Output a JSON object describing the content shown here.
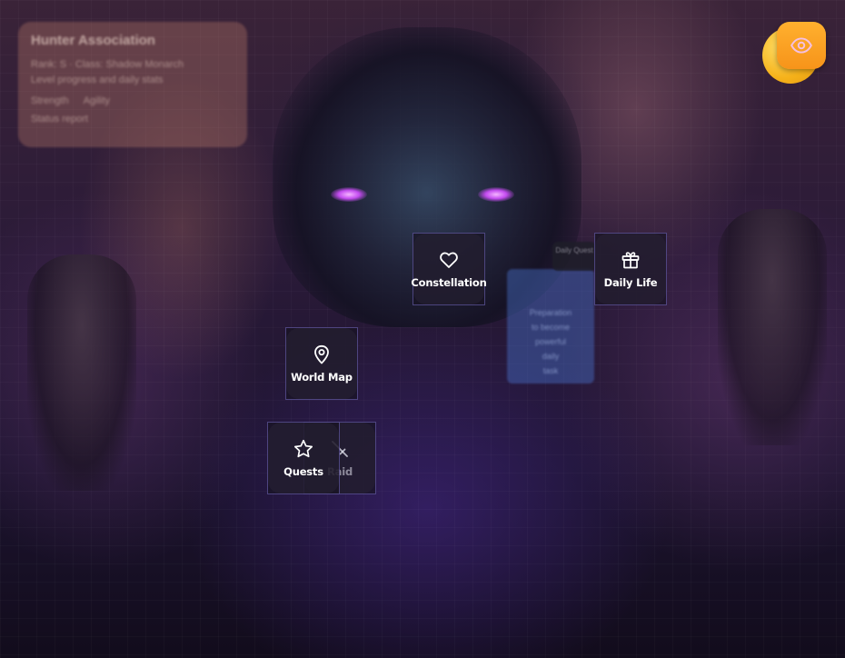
{
  "background_panel": {
    "title": "Hunter Association",
    "lines": [
      "Rank: S · Class: Shadow Monarch",
      "Level progress and daily stats"
    ],
    "stats": [
      "Strength",
      "Agility"
    ],
    "footer": "Status report"
  },
  "note_card": {
    "tab": "Daily Quest",
    "lines": [
      "Preparation",
      "to become",
      "powerful",
      "daily",
      "task"
    ]
  },
  "visibility_toggle": {
    "icon": "eye-icon",
    "colors": {
      "front": "#f7941a",
      "back": "#f6b21a",
      "icon": "#f0b8e0"
    }
  },
  "menu": {
    "items": [
      {
        "id": "constellation",
        "label": "Constellation",
        "icon": "heart-icon"
      },
      {
        "id": "daily_life",
        "label": "Daily Life",
        "icon": "gift-icon"
      },
      {
        "id": "world_map",
        "label": "World Map",
        "icon": "map-pin-icon"
      },
      {
        "id": "quests",
        "label": "Quests",
        "icon": "star-icon"
      },
      {
        "id": "raid",
        "label": "Raid",
        "icon": "sword-icon"
      }
    ]
  },
  "theme": {
    "tile_border": "#7a6ec8",
    "tile_bg": "#181422",
    "accent_eye_glow": "#c44cf0"
  }
}
